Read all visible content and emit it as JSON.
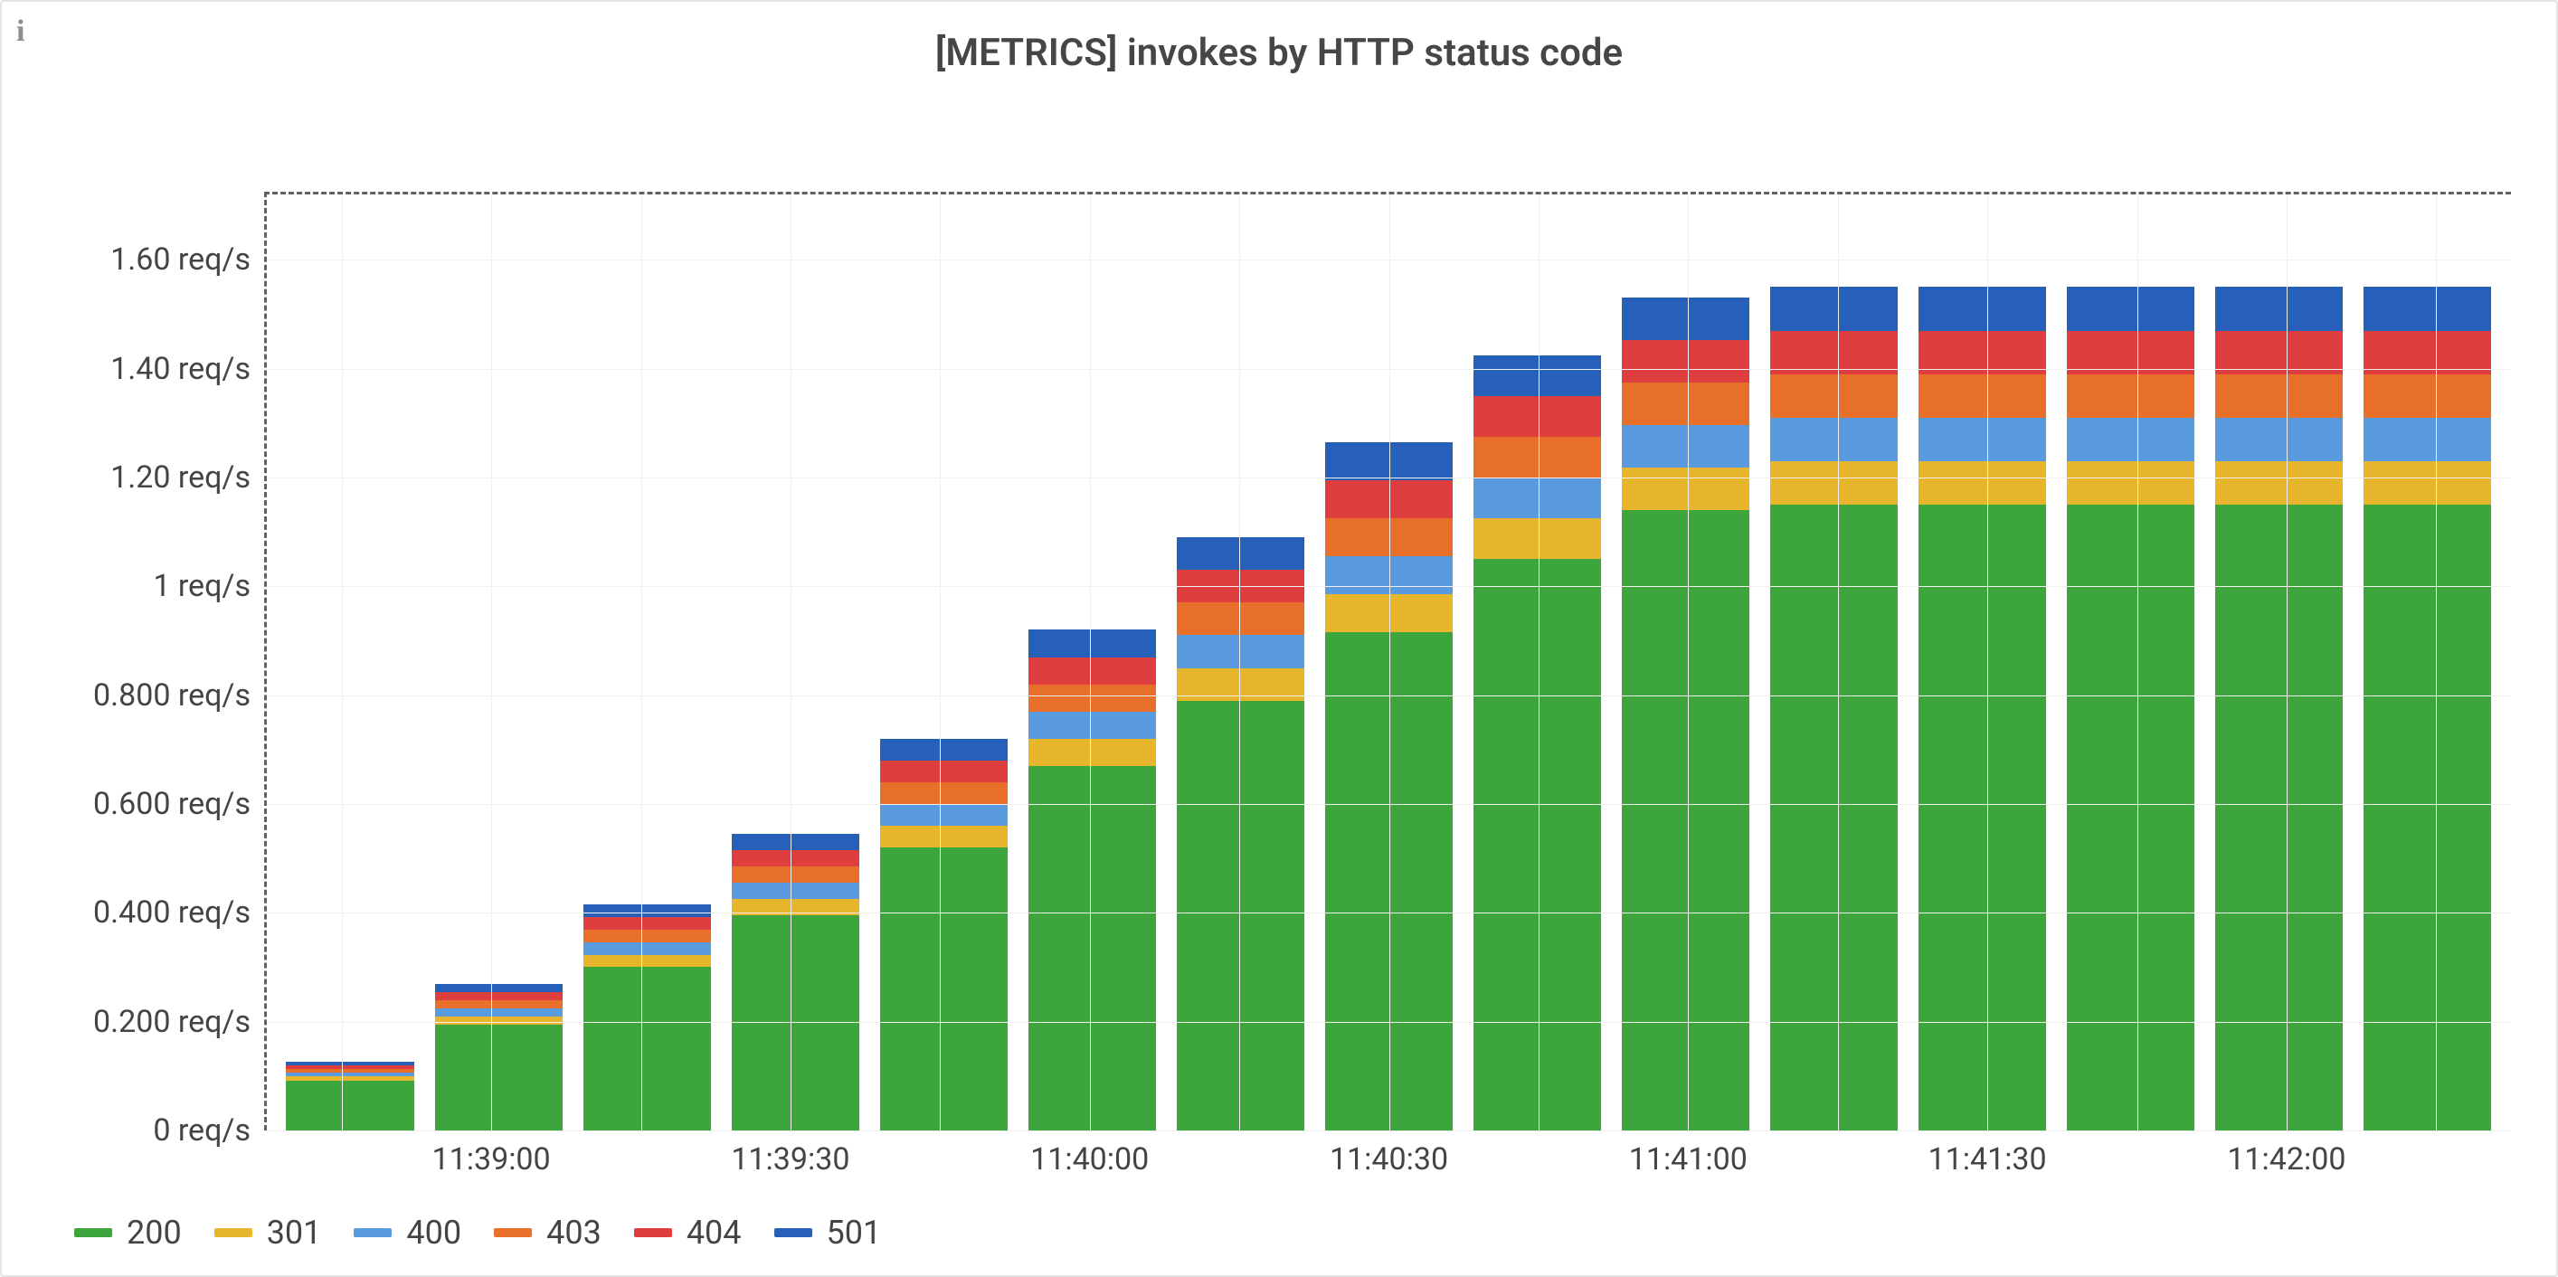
{
  "title": "[METRICS] invokes by HTTP status code",
  "info_icon": "i",
  "chart_data": {
    "type": "bar",
    "stacked": true,
    "ylabel": "",
    "xlabel": "",
    "ylim": [
      0,
      1.72
    ],
    "y_ticks": [
      {
        "v": 0.0,
        "label": "0 req/s"
      },
      {
        "v": 0.2,
        "label": "0.200 req/s"
      },
      {
        "v": 0.4,
        "label": "0.400 req/s"
      },
      {
        "v": 0.6,
        "label": "0.600 req/s"
      },
      {
        "v": 0.8,
        "label": "0.800 req/s"
      },
      {
        "v": 1.0,
        "label": "1 req/s"
      },
      {
        "v": 1.2,
        "label": "1.20 req/s"
      },
      {
        "v": 1.4,
        "label": "1.40 req/s"
      },
      {
        "v": 1.6,
        "label": "1.60 req/s"
      }
    ],
    "categories": [
      "11:38:45",
      "11:39:00",
      "11:39:15",
      "11:39:30",
      "11:39:45",
      "11:40:00",
      "11:40:15",
      "11:40:30",
      "11:40:45",
      "11:41:00",
      "11:41:15",
      "11:41:30",
      "11:41:45",
      "11:42:00",
      "11:42:15"
    ],
    "x_ticks_at": [
      "11:39:00",
      "11:39:30",
      "11:40:00",
      "11:40:30",
      "11:41:00",
      "11:41:30",
      "11:42:00"
    ],
    "series": [
      {
        "name": "200",
        "color": "#3ca63c",
        "values": [
          0.092,
          0.195,
          0.3,
          0.395,
          0.52,
          0.67,
          0.79,
          0.915,
          1.05,
          1.14,
          1.15,
          1.15,
          1.15,
          1.15,
          1.15
        ]
      },
      {
        "name": "301",
        "color": "#e8b62c",
        "values": [
          0.007,
          0.015,
          0.023,
          0.03,
          0.04,
          0.05,
          0.06,
          0.07,
          0.075,
          0.078,
          0.08,
          0.08,
          0.08,
          0.08,
          0.08
        ]
      },
      {
        "name": "400",
        "color": "#5a9adf",
        "values": [
          0.007,
          0.015,
          0.023,
          0.03,
          0.04,
          0.05,
          0.06,
          0.07,
          0.075,
          0.078,
          0.08,
          0.08,
          0.08,
          0.08,
          0.08
        ]
      },
      {
        "name": "403",
        "color": "#e8702a",
        "values": [
          0.007,
          0.015,
          0.023,
          0.03,
          0.04,
          0.05,
          0.06,
          0.07,
          0.075,
          0.078,
          0.08,
          0.08,
          0.08,
          0.08,
          0.08
        ]
      },
      {
        "name": "404",
        "color": "#df3e3e",
        "values": [
          0.007,
          0.015,
          0.023,
          0.03,
          0.04,
          0.05,
          0.06,
          0.07,
          0.075,
          0.078,
          0.08,
          0.08,
          0.08,
          0.08,
          0.08
        ]
      },
      {
        "name": "501",
        "color": "#2660b9",
        "values": [
          0.007,
          0.015,
          0.023,
          0.03,
          0.04,
          0.05,
          0.06,
          0.07,
          0.075,
          0.078,
          0.08,
          0.08,
          0.08,
          0.08,
          0.08
        ]
      }
    ]
  },
  "legend": [
    {
      "label": "200",
      "color": "#3ca63c"
    },
    {
      "label": "301",
      "color": "#e8b62c"
    },
    {
      "label": "400",
      "color": "#5a9adf"
    },
    {
      "label": "403",
      "color": "#e8702a"
    },
    {
      "label": "404",
      "color": "#df3e3e"
    },
    {
      "label": "501",
      "color": "#2660b9"
    }
  ]
}
